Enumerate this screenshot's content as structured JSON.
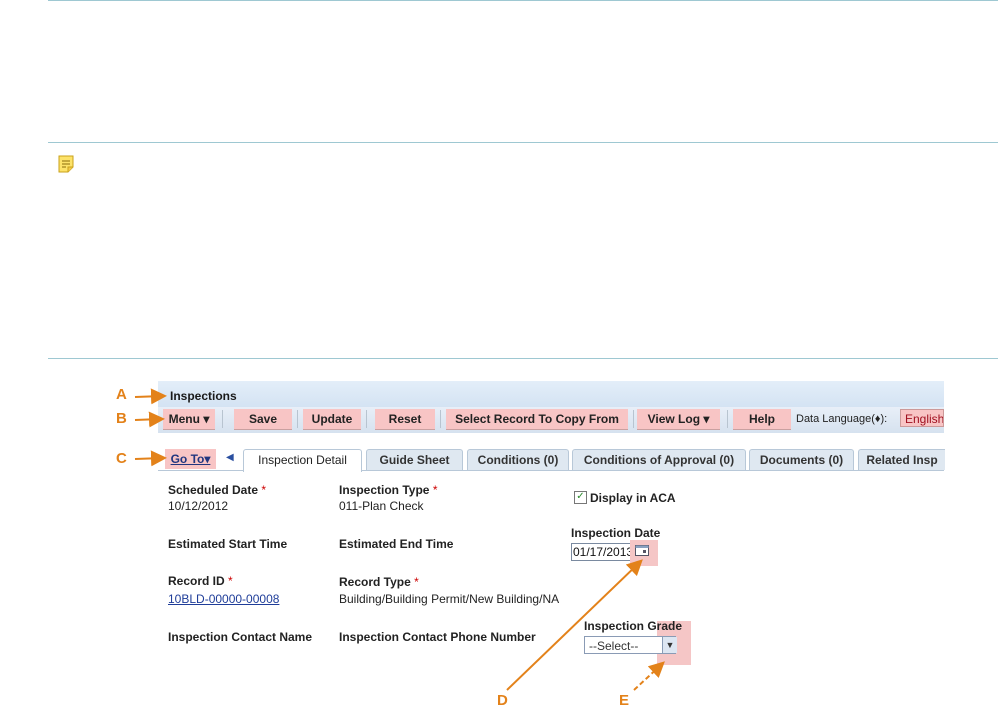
{
  "panel": {
    "title": "Inspections"
  },
  "toolbar": {
    "menu": "Menu",
    "save": "Save",
    "update": "Update",
    "reset": "Reset",
    "copy_from": "Select Record To Copy From",
    "view_log": "View Log",
    "help": "Help",
    "data_language_label": "Data Language(♦):",
    "data_language_value": "English"
  },
  "tabs": {
    "goto": "Go To▾",
    "items": [
      "Inspection Detail",
      "Guide Sheet",
      "Conditions (0)",
      "Conditions of Approval (0)",
      "Documents (0)",
      "Related Insp"
    ]
  },
  "form": {
    "scheduled_date_label": "Scheduled Date",
    "scheduled_date_value": "10/12/2012",
    "inspection_type_label": "Inspection Type",
    "inspection_type_value": "011-Plan Check",
    "display_aca_label": "Display in ACA",
    "display_aca_checked": true,
    "estimated_start_label": "Estimated Start Time",
    "estimated_end_label": "Estimated End Time",
    "inspection_date_label": "Inspection Date",
    "inspection_date_value": "01/17/2013",
    "record_id_label": "Record ID",
    "record_id_value": "10BLD-00000-00008",
    "record_type_label": "Record Type",
    "record_type_value": "Building/Building Permit/New Building/NA",
    "contact_name_label": "Inspection Contact Name",
    "contact_phone_label": "Inspection Contact Phone Number",
    "inspection_grade_label": "Inspection Grade",
    "inspection_grade_value": "--Select--",
    "required_mark": "*"
  },
  "callouts": {
    "a": "A",
    "b": "B",
    "c": "C",
    "d": "D",
    "e": "E"
  },
  "colors": {
    "callout": "#e3821a",
    "highlight": "#f5c6c6",
    "divider": "#9ec8d2"
  },
  "icons": {
    "note": "note-icon",
    "calendar": "calendar-icon",
    "dropdown": "chevron-down-icon",
    "checkbox": "checkbox-checked-icon",
    "tab_scroll": "caret-left-icon"
  }
}
